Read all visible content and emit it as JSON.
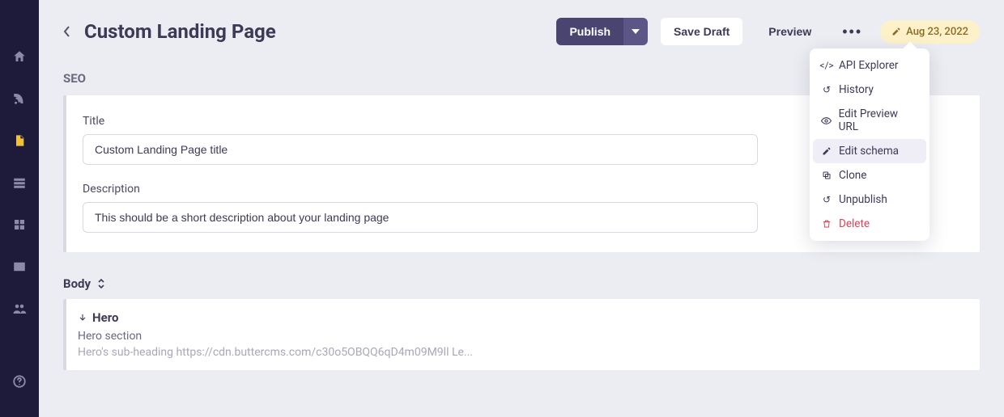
{
  "header": {
    "title": "Custom Landing Page",
    "publish_label": "Publish",
    "save_draft_label": "Save Draft",
    "preview_label": "Preview",
    "date_badge": "Aug 23, 2022"
  },
  "dropdown": {
    "api_explorer": "API Explorer",
    "history": "History",
    "edit_preview_url": "Edit Preview URL",
    "edit_schema": "Edit schema",
    "clone": "Clone",
    "unpublish": "Unpublish",
    "delete": "Delete"
  },
  "seo": {
    "section_label": "SEO",
    "title_label": "Title",
    "title_value": "Custom Landing Page title",
    "description_label": "Description",
    "description_value": "This should be a short description about your landing page"
  },
  "body": {
    "section_label": "Body",
    "hero_label": "Hero",
    "hero_section_label": "Hero section",
    "hero_summary": "Hero's sub-heading https://cdn.buttercms.com/c30o5OBQQ6qD4m09M9ll Le..."
  }
}
